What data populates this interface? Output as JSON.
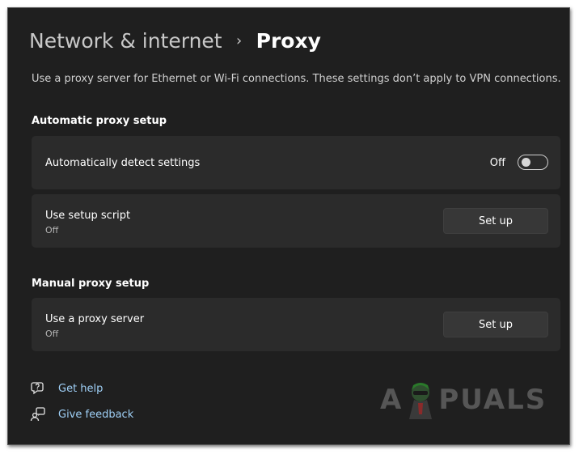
{
  "breadcrumb": {
    "parent": "Network & internet",
    "separator": "›",
    "current": "Proxy"
  },
  "description": "Use a proxy server for Ethernet or Wi-Fi connections. These settings don’t apply to VPN connections.",
  "automatic_section": {
    "title": "Automatic proxy setup",
    "auto_detect": {
      "label": "Automatically detect settings",
      "toggle_label": "Off",
      "toggle_on": false
    },
    "setup_script": {
      "label": "Use setup script",
      "status": "Off",
      "button": "Set up"
    }
  },
  "manual_section": {
    "title": "Manual proxy setup",
    "proxy_server": {
      "label": "Use a proxy server",
      "status": "Off",
      "button": "Set up"
    }
  },
  "links": {
    "help": "Get help",
    "feedback": "Give feedback"
  },
  "watermark": {
    "left": "A",
    "right": "PUALS"
  },
  "colors": {
    "background": "#1f1f1f",
    "card": "#2b2b2b",
    "link": "#9fd0f7"
  }
}
